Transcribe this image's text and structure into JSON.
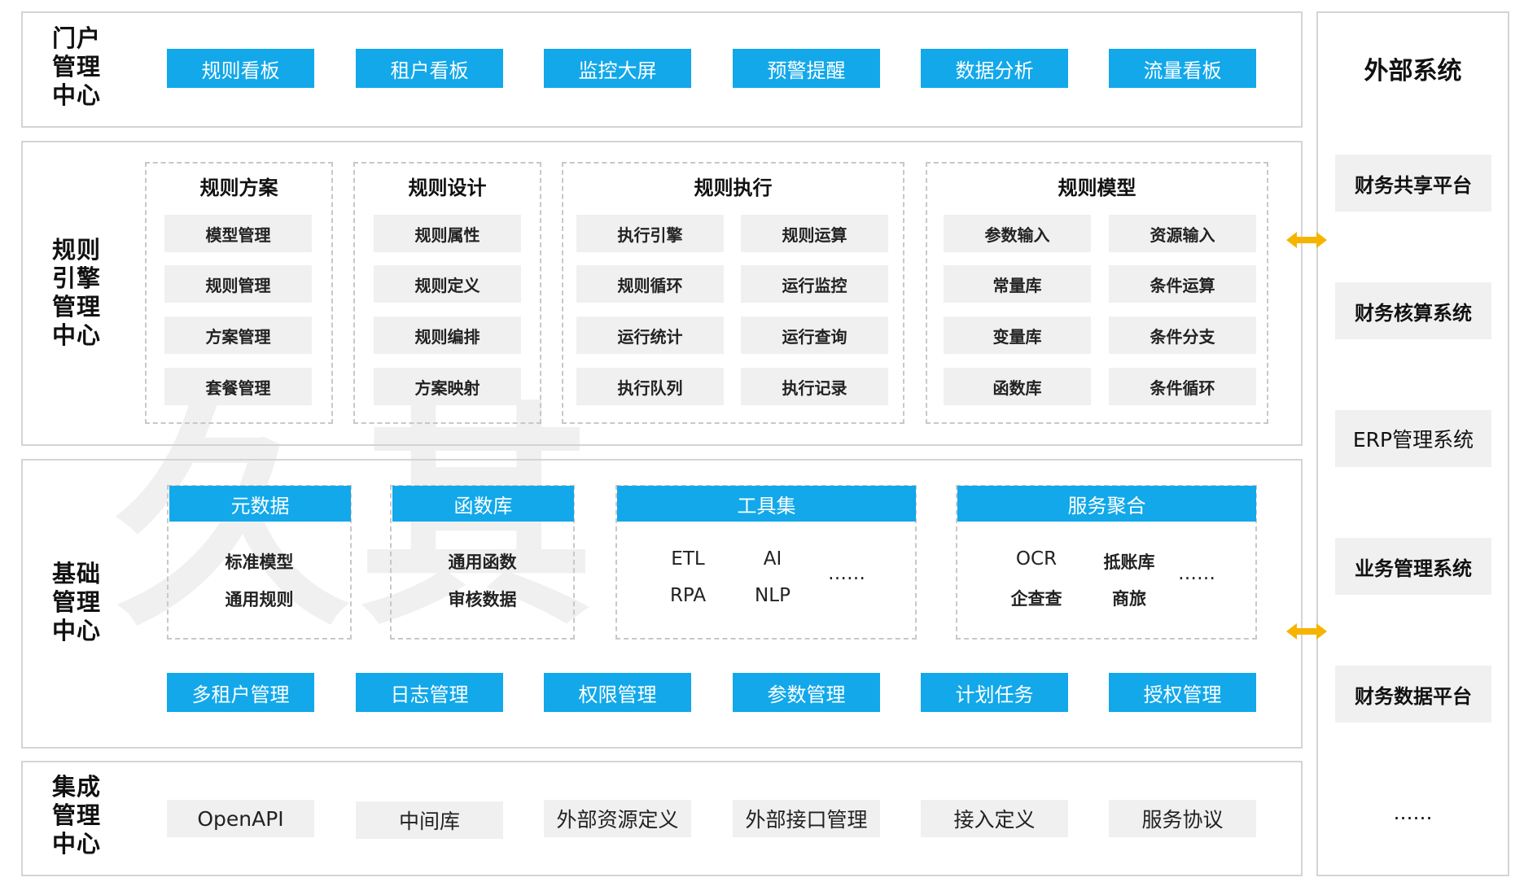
{
  "watermark": "久其",
  "portal": {
    "label": [
      "门户",
      "管理",
      "中心"
    ],
    "buttons": [
      "规则看板",
      "租户看板",
      "监控大屏",
      "预警提醒",
      "数据分析",
      "流量看板"
    ]
  },
  "rules": {
    "label": [
      "规则",
      "引擎",
      "管理",
      "中心"
    ],
    "groups": [
      {
        "title": "规则方案",
        "items": [
          "模型管理",
          "规则管理",
          "方案管理",
          "套餐管理"
        ]
      },
      {
        "title": "规则设计",
        "items": [
          "规则属性",
          "规则定义",
          "规则编排",
          "方案映射"
        ]
      },
      {
        "title": "规则执行",
        "items": [
          "执行引擎",
          "规则运算",
          "规则循环",
          "运行监控",
          "运行统计",
          "运行查询",
          "执行队列",
          "执行记录"
        ]
      },
      {
        "title": "规则模型",
        "items": [
          "参数输入",
          "资源输入",
          "常量库",
          "条件运算",
          "变量库",
          "条件分支",
          "函数库",
          "条件循环"
        ]
      }
    ]
  },
  "base": {
    "label": [
      "基础",
      "管理",
      "中心"
    ],
    "modules": [
      {
        "title": "元数据",
        "rows": [
          [
            "标准模型"
          ],
          [
            "通用规则"
          ]
        ]
      },
      {
        "title": "函数库",
        "rows": [
          [
            "通用函数"
          ],
          [
            "审核数据"
          ]
        ]
      },
      {
        "title": "工具集",
        "rows": [
          [
            "ETL",
            "AI"
          ],
          [
            "RPA",
            "NLP"
          ]
        ],
        "more": "……"
      },
      {
        "title": "服务聚合",
        "rows": [
          [
            "OCR",
            "抵账库"
          ],
          [
            "企查查",
            "商旅"
          ]
        ],
        "more": "……"
      }
    ],
    "buttons": [
      "多租户管理",
      "日志管理",
      "权限管理",
      "参数管理",
      "计划任务",
      "授权管理"
    ]
  },
  "integration": {
    "label": [
      "集成",
      "管理",
      "中心"
    ],
    "buttons": [
      "OpenAPI",
      "中间库",
      "外部资源定义",
      "外部接口管理",
      "接入定义",
      "服务协议"
    ]
  },
  "external": {
    "title": "外部系统",
    "systems": [
      "财务共享平台",
      "财务核算系统",
      "ERP管理系统",
      "业务管理系统",
      "财务数据平台"
    ],
    "more": "……"
  },
  "colors": {
    "accent": "#12a8ea",
    "arrow": "#f5b400",
    "box": "#f0f0f0",
    "border": "#d4d4d4"
  },
  "icons": {
    "arrow": "double-arrow-icon"
  }
}
